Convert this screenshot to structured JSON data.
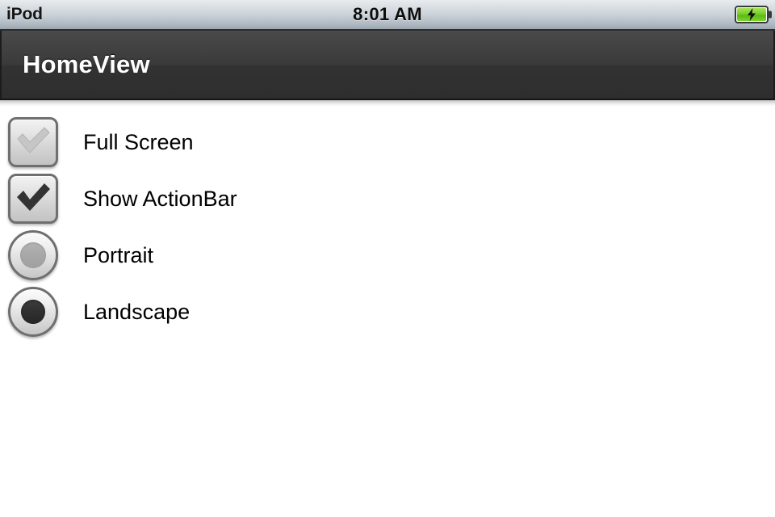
{
  "status_bar": {
    "carrier": "iPod",
    "time": "8:01 AM",
    "battery_icon": "battery-charging-icon",
    "battery_color": "#7cd12e"
  },
  "nav_bar": {
    "title": "HomeView",
    "background_color": "#3a3a3a",
    "title_color": "#ffffff"
  },
  "content": {
    "background_color": "#ffffff",
    "rows": [
      {
        "control": "checkbox",
        "icon": "checkbox-unchecked-icon",
        "checked": false,
        "label": "Full Screen",
        "check_color": "#c0c0c0"
      },
      {
        "control": "checkbox",
        "icon": "checkbox-checked-icon",
        "checked": true,
        "label": "Show ActionBar",
        "check_color": "#333333"
      },
      {
        "control": "radio",
        "icon": "radio-unselected-icon",
        "selected": false,
        "label": "Portrait",
        "dot_color": "#a8a8a8"
      },
      {
        "control": "radio",
        "icon": "radio-selected-icon",
        "selected": true,
        "label": "Landscape",
        "dot_color": "#303030"
      }
    ]
  }
}
